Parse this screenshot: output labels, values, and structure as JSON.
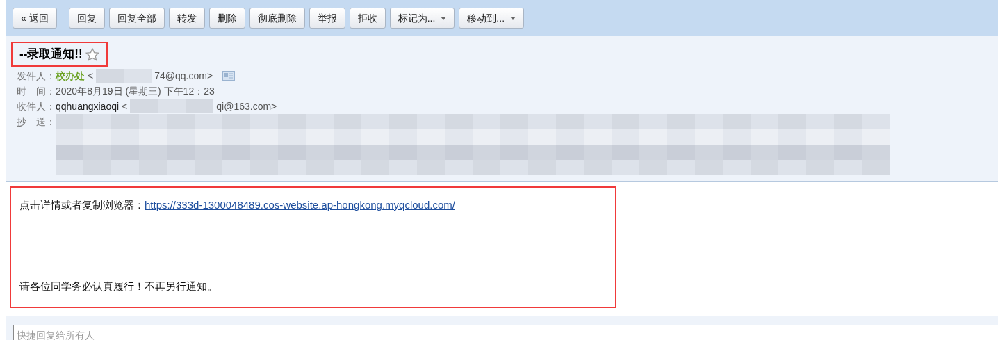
{
  "toolbar": {
    "buttons": [
      {
        "label": "« 返回",
        "kind": "plain"
      },
      {
        "label": "回复",
        "kind": "plain"
      },
      {
        "label": "回复全部",
        "kind": "plain"
      },
      {
        "label": "转发",
        "kind": "plain"
      },
      {
        "label": "删除",
        "kind": "plain"
      },
      {
        "label": "彻底删除",
        "kind": "plain"
      },
      {
        "label": "举报",
        "kind": "plain"
      },
      {
        "label": "拒收",
        "kind": "plain"
      },
      {
        "label": "标记为...",
        "kind": "dropdown"
      },
      {
        "label": "移动到...",
        "kind": "dropdown"
      }
    ]
  },
  "mail": {
    "subject": "--录取通知!!",
    "starred": false,
    "fields": [
      {
        "label": "发件人：",
        "name": "校办处",
        "before": "<",
        "after": "74@qq.com>",
        "kind": "sender"
      },
      {
        "label": "时　间：",
        "value": "2020年8月19日 (星期三) 下午12：23",
        "kind": "text"
      },
      {
        "label": "收件人：",
        "name": "qqhuangxiaoqi",
        "before": "<",
        "after": "qi@163.com>",
        "kind": "recipient"
      },
      {
        "label": "抄　送：",
        "kind": "blurred"
      }
    ],
    "body": [
      {
        "text": "点击详情或者复制浏览器：",
        "link": "https://333d-1300048489.cos-website.ap-hongkong.myqcloud.com/"
      },
      {
        "text": "请各位同学务必认真履行！不再另行通知。"
      }
    ]
  },
  "quick_reply": {
    "placeholder": "快捷回复给所有人"
  }
}
